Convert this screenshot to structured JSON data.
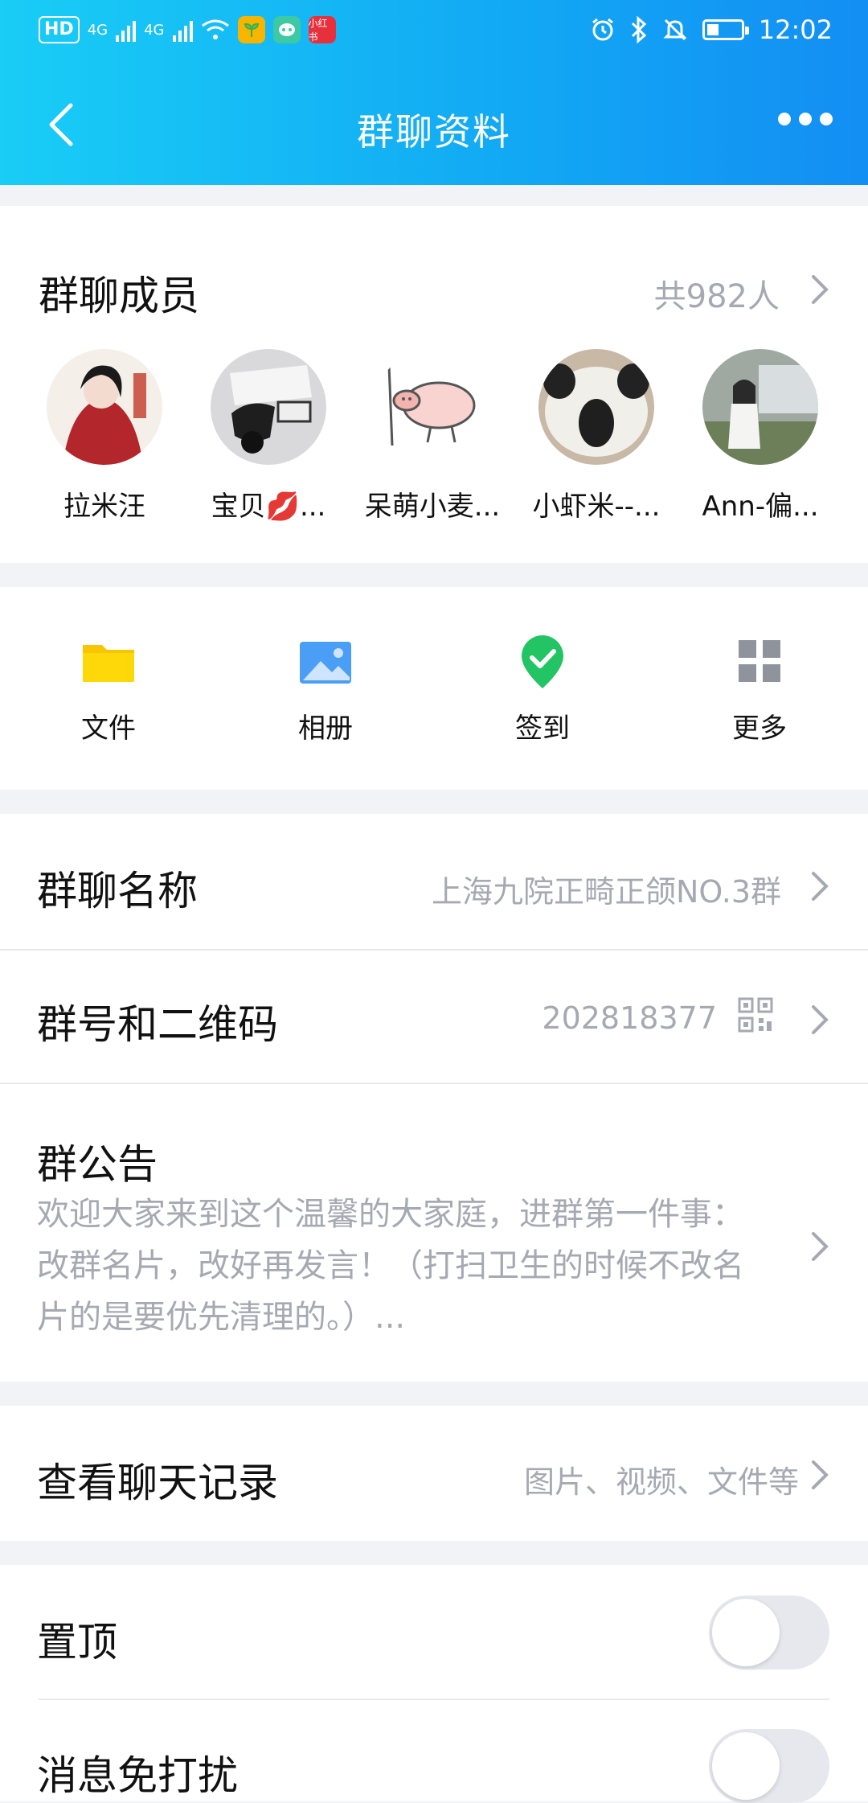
{
  "status_bar": {
    "hd": "HD",
    "net1": "4G",
    "net2": "4G",
    "app_xhs": "小红书",
    "time": "12:02"
  },
  "navbar": {
    "title": "群聊资料"
  },
  "members": {
    "title": "群聊成员",
    "count": "共982人",
    "list": [
      {
        "name": "拉米汪"
      },
      {
        "name": "宝贝💋..."
      },
      {
        "name": "呆萌小麦..."
      },
      {
        "name": "小虾米--..."
      },
      {
        "name": "Ann-偏..."
      }
    ]
  },
  "tools": [
    {
      "label": "文件",
      "icon": "folder-icon"
    },
    {
      "label": "相册",
      "icon": "photo-icon"
    },
    {
      "label": "签到",
      "icon": "checkin-icon"
    },
    {
      "label": "更多",
      "icon": "grid-icon"
    }
  ],
  "group_name": {
    "title": "群聊名称",
    "value": "上海九院正畸正颌NO.3群"
  },
  "group_id": {
    "title": "群号和二维码",
    "value": "202818377"
  },
  "notice": {
    "title": "群公告",
    "line1": "欢迎大家来到这个温馨的大家庭，进群第一件事：",
    "line2": "改群名片，改好再发言！（打扫卫生的时候不改名",
    "line3": "片的是要优先清理的。）..."
  },
  "history": {
    "title": "查看聊天记录",
    "value": "图片、视频、文件等"
  },
  "settings": {
    "pin_label": "置顶",
    "pin_on": false,
    "dnd_label": "消息免打扰",
    "dnd_on": false
  },
  "colors": {
    "header_gradient_start": "#19cdf6",
    "header_gradient_end": "#138ef3",
    "secondary_text": "#a6a9b2"
  }
}
